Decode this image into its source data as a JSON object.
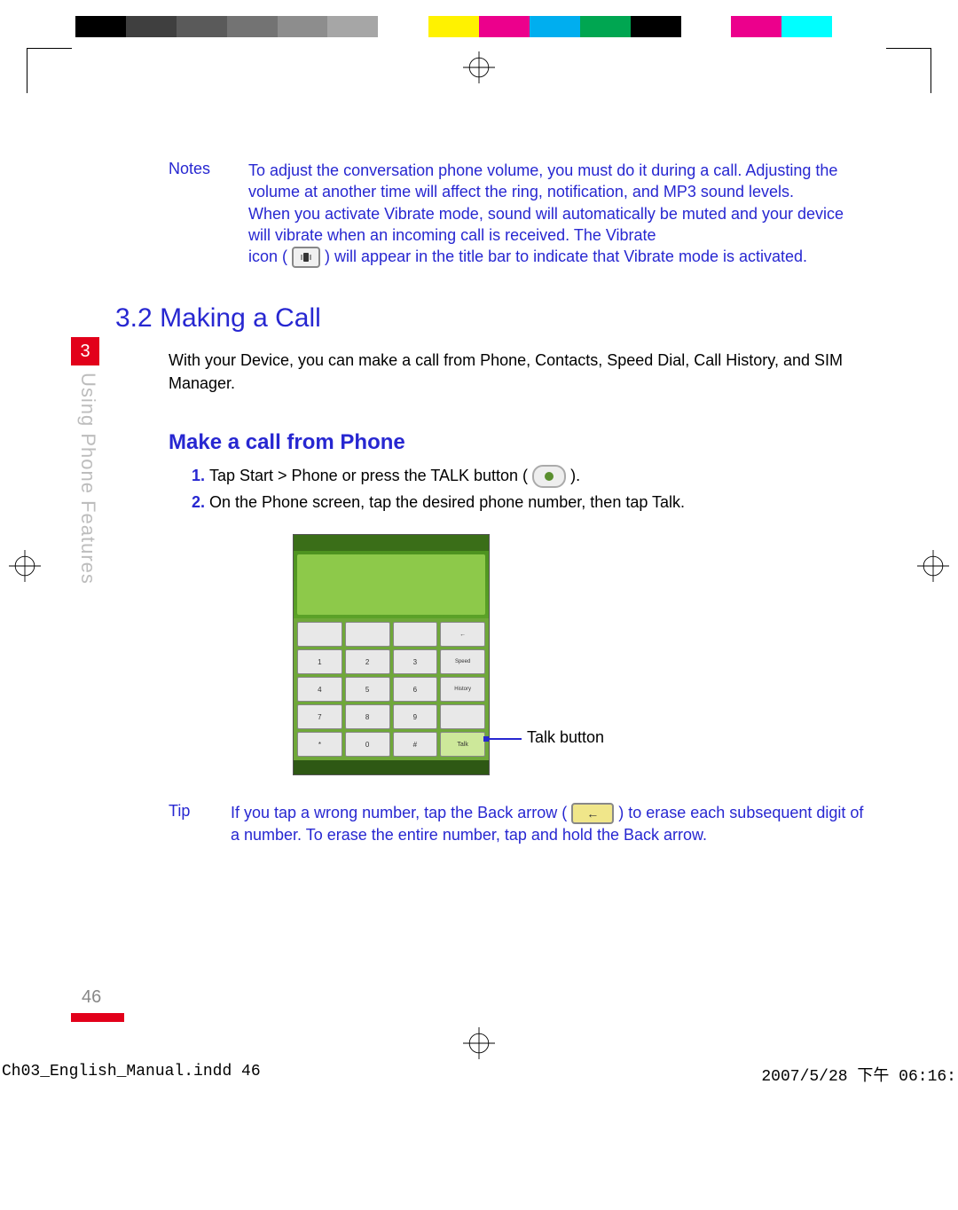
{
  "colorbar": [
    "#000000",
    "#3f3f3f",
    "#5a5a5a",
    "#737373",
    "#8d8d8d",
    "#a6a6a6",
    "#ffffff",
    "#fff200",
    "#ec008c",
    "#00aeef",
    "#00a651",
    "#000000",
    "#ffffff",
    "#ec008c",
    "#00ffff",
    "#ffffff"
  ],
  "chapter_tab": "3",
  "vertical_label": "Using Phone Features",
  "notes": {
    "label": "Notes",
    "line1": "To adjust the conversation phone volume, you must do it during a call. Adjusting the volume at another time will affect the ring, notification, and MP3 sound levels.",
    "line2a": "When you activate Vibrate mode, sound will automatically be muted and your device will vibrate when an incoming call is received. The Vibrate",
    "line2b_pre": "icon (",
    "line2b_post": ") will appear in the title bar to indicate that Vibrate mode is activated."
  },
  "section": {
    "number": "3.2",
    "title": "Making a Call",
    "intro": "With your Device, you can make a call from Phone, Contacts, Speed Dial, Call History, and SIM Manager."
  },
  "subhead": "Make a call from Phone",
  "steps": {
    "s1_pre": "Tap Start > Phone or press the TALK button (",
    "s1_post": ").",
    "s2": "On the Phone screen, tap the desired phone number, then tap Talk."
  },
  "callout": "Talk button",
  "tip": {
    "label": "Tip",
    "pre": "If you tap a wrong number, tap the Back arrow (",
    "post": ") to erase each subsequent digit of a number. To erase the entire number, tap and hold the Back arrow."
  },
  "page_number": "46",
  "slug": {
    "file": "Ch03_English_Manual.indd   46",
    "date": "2007/5/28   下午 06:16:"
  }
}
